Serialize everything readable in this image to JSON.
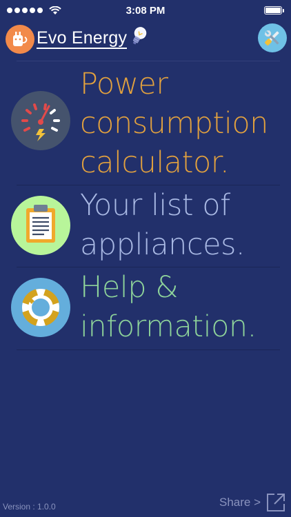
{
  "status_bar": {
    "time": "3:08 PM"
  },
  "header": {
    "title": "Evo Energy"
  },
  "menu": [
    {
      "lines": [
        "Power",
        "consumption",
        "calculator."
      ],
      "color": "#e2a13e",
      "icon": "speedometer-icon"
    },
    {
      "lines": [
        "Your list of",
        "appliances."
      ],
      "color": "#a9b9e4",
      "icon": "clipboard-icon"
    },
    {
      "lines": [
        "Help &",
        "information."
      ],
      "color": "#8ed39a",
      "icon": "lifebuoy-icon"
    }
  ],
  "footer": {
    "version": "Version : 1.0.0",
    "share_label": "Share >"
  },
  "colors": {
    "background": "#22306b",
    "calculator": "#e2a13e",
    "appliances": "#a9b9e4",
    "help": "#8ed39a"
  }
}
